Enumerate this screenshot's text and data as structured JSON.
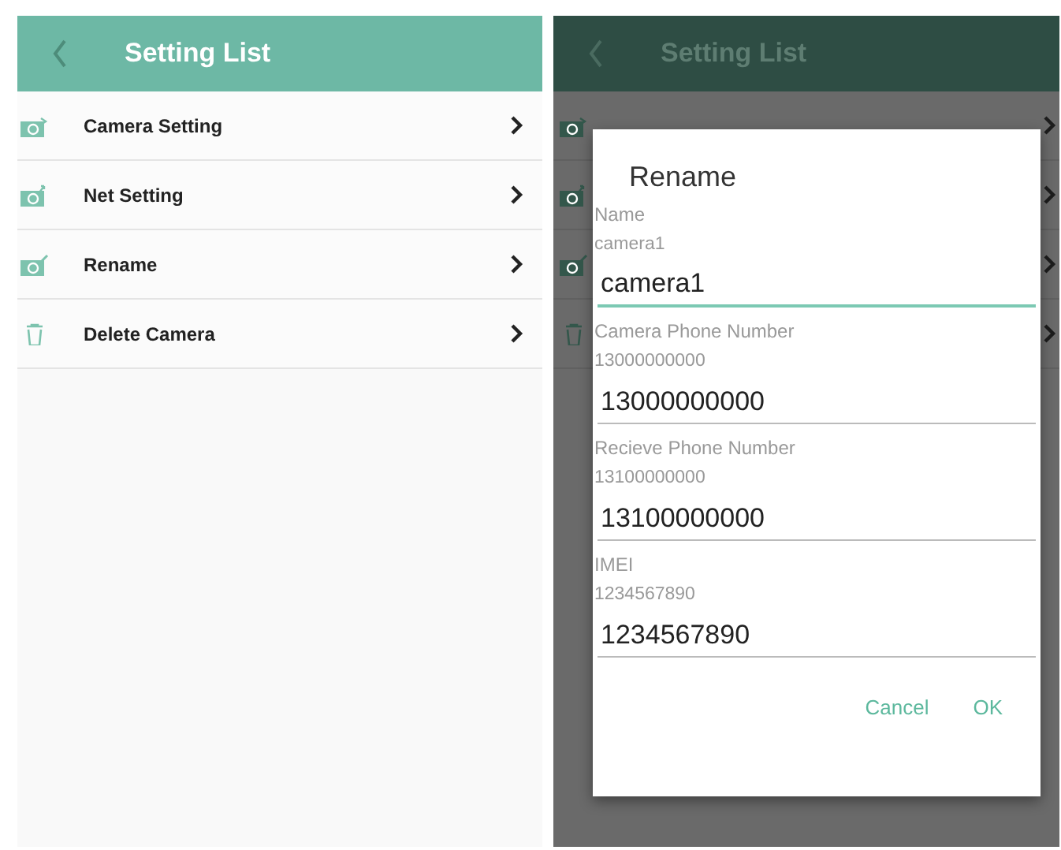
{
  "settings_screen": {
    "title": "Setting List",
    "items": [
      {
        "label": "Camera Setting",
        "kind": "camera"
      },
      {
        "label": "Net Setting",
        "kind": "camera-share"
      },
      {
        "label": "Rename",
        "kind": "camera-edit"
      },
      {
        "label": "Delete Camera",
        "kind": "trash"
      }
    ]
  },
  "dimmed_screen": {
    "title": "Setting List"
  },
  "rename_dialog": {
    "title": "Rename",
    "fields": [
      {
        "label": "Name",
        "hint": "camera1",
        "value": "camera1",
        "focused": true
      },
      {
        "label": "Camera Phone Number",
        "hint": "13000000000",
        "value": "13000000000",
        "focused": false
      },
      {
        "label": "Recieve Phone Number",
        "hint": "13100000000",
        "value": "13100000000",
        "focused": false
      },
      {
        "label": "IMEI",
        "hint": "1234567890",
        "value": "1234567890",
        "focused": false
      }
    ],
    "buttons": [
      "Cancel",
      "OK"
    ]
  }
}
